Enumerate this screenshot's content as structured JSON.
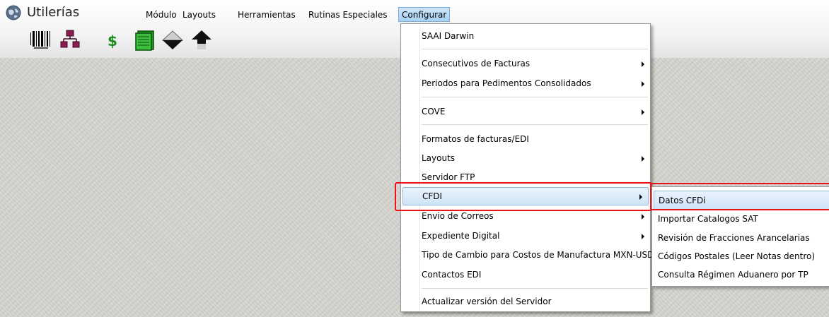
{
  "app": {
    "title": "Utilerías"
  },
  "menubar": {
    "items": [
      {
        "label": "Módulo"
      },
      {
        "label": "Layouts"
      },
      {
        "label": "Herramientas"
      },
      {
        "label": "Rutinas Especiales"
      },
      {
        "label": "Configurar"
      }
    ],
    "active": "Configurar"
  },
  "toolbar": {
    "icons": [
      "barcode-icon",
      "org-chart-icon",
      "dollar-icon",
      "ledger-icon",
      "arrow-down-icon",
      "arrow-up-icon"
    ]
  },
  "configurar_menu": {
    "items": [
      {
        "label": "SAAI Darwin",
        "submenu": false
      },
      {
        "label": "Consecutivos de Facturas",
        "submenu": true
      },
      {
        "label": "Periodos para Pedimentos Consolidados",
        "submenu": true
      },
      {
        "label": "COVE",
        "submenu": true
      },
      {
        "label": "Formatos de facturas/EDI",
        "submenu": false
      },
      {
        "label": "Layouts",
        "submenu": true
      },
      {
        "label": "Servidor FTP",
        "submenu": false
      },
      {
        "label": "CFDI",
        "submenu": true,
        "highlighted": true
      },
      {
        "label": "Envio de Correos",
        "submenu": true
      },
      {
        "label": "Expediente Digital",
        "submenu": true
      },
      {
        "label": "Tipo de Cambio para Costos de Manufactura MXN-USD",
        "submenu": false
      },
      {
        "label": "Contactos EDI",
        "submenu": false
      },
      {
        "label": "Actualizar versión del Servidor",
        "submenu": false
      }
    ]
  },
  "cfdi_submenu": {
    "items": [
      {
        "label": "Datos CFDi",
        "highlighted": true
      },
      {
        "label": "Importar Catalogos SAT"
      },
      {
        "label": "Revisión de Fracciones Arancelarias"
      },
      {
        "label": "Códigos Postales (Leer Notas dentro)"
      },
      {
        "label": "Consulta Régimen Aduanero por TP"
      }
    ]
  },
  "colors": {
    "highlight_border": "#e8141a",
    "menu_highlight": "#cfe4f7"
  }
}
